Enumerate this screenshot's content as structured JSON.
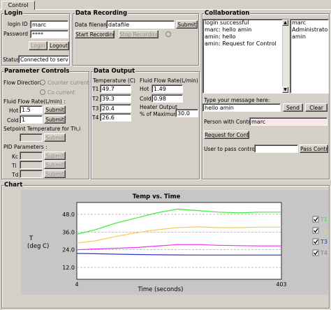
{
  "tab": {
    "label": "Control"
  },
  "login": {
    "title": "Login",
    "id_label": "login ID :",
    "id_value": "marc",
    "password_label": "Password :",
    "password_value": "****",
    "login_button": "Login",
    "logout_button": "Logout",
    "status_label": "Status",
    "status_value": "Connected to server"
  },
  "recording": {
    "title": "Data Recording",
    "filename_label": "Data filename",
    "filename_value": "datafile",
    "submit_button": "Submit",
    "start_button": "Start Recording",
    "stop_button": "Stop Recording"
  },
  "collaboration": {
    "title": "Collaboration",
    "messages": [
      "login successful",
      "marc: hello amin",
      "amin: hello",
      "amin: Request for Control"
    ],
    "users": [
      "marc",
      "Administrator",
      "amin"
    ],
    "type_label": "Type your message here:",
    "message_value": "hello amin",
    "send_button": "Send",
    "clear_button": "Clear",
    "person_label": "Person with Control",
    "person_value": "marc",
    "request_button": "Request for Control",
    "pass_label": "User to pass control to",
    "pass_value": "",
    "pass_button": "Pass Control"
  },
  "params": {
    "title": "Parameter Controls",
    "flow_direction_label": "Flow Direction",
    "counter_current": "Counter current",
    "co_current": "Co current",
    "flow_rate_label": "Fluid Flow Rate(L/min) :",
    "hot_label": "Hot",
    "hot_value": "1.5",
    "cold_label": "Cold",
    "cold_value": "1",
    "submit_label": "Submit",
    "setpoint_label": "Setpoint Temperature for Th,i",
    "pid_label": "PID Parameters :",
    "kc_label": "Kc",
    "ti_label": "Ti",
    "td_label": "Td"
  },
  "output": {
    "title": "Data Output",
    "temp_label": "Temperature (C)",
    "temps": [
      {
        "label": "T1",
        "value": "49.7"
      },
      {
        "label": "T2",
        "value": "39.3"
      },
      {
        "label": "T3",
        "value": "20.4"
      },
      {
        "label": "T4",
        "value": "26.6"
      }
    ],
    "flow_label_1": "Fluid Flow Rate(L/min)",
    "hot_label": "Hot",
    "hot_value": "1.49",
    "cold_label": "Cold",
    "cold_value": "0.98",
    "heater_label_1": "Heater Output",
    "heater_label_2": "% of Maximum",
    "heater_value": "30.0"
  },
  "chart_section": {
    "title": "Chart"
  },
  "chart_data": {
    "type": "line",
    "title": "Temp vs. Time",
    "xlabel": "Time (seconds)",
    "ylabel_line1": "T",
    "ylabel_line2": "(deg C)",
    "xlim": [
      4,
      403
    ],
    "ylim": [
      4,
      56
    ],
    "x_ticks": [
      "4",
      "403"
    ],
    "y_ticks": [
      "48.0",
      "36.0",
      "24.0",
      "12.0"
    ],
    "y_tick_values": [
      48,
      36,
      24,
      12
    ],
    "grid": true,
    "legend_position": "right",
    "series": [
      {
        "name": "T1",
        "color": "#33ee33",
        "x": [
          4,
          40,
          80,
          120,
          160,
          200,
          240,
          280,
          320,
          360,
          403
        ],
        "y": [
          34.5,
          37.5,
          42.0,
          45.5,
          49.0,
          51.5,
          50.5,
          49.5,
          49.0,
          49.5,
          49.5
        ]
      },
      {
        "name": "T2",
        "color": "#ffc850",
        "x": [
          4,
          40,
          80,
          120,
          160,
          200,
          240,
          280,
          320,
          360,
          403
        ],
        "y": [
          28.5,
          30.0,
          33.0,
          35.5,
          37.5,
          39.0,
          39.5,
          39.0,
          39.0,
          39.3,
          39.3
        ]
      },
      {
        "name": "T3",
        "color": "#3333cc",
        "x": [
          4,
          40,
          80,
          120,
          160,
          200,
          240,
          280,
          320,
          360,
          403
        ],
        "y": [
          21.5,
          21.3,
          21.0,
          20.8,
          20.6,
          20.5,
          20.4,
          20.4,
          20.4,
          20.4,
          20.4
        ]
      },
      {
        "name": "T4",
        "color": "#ee33ee",
        "x": [
          4,
          40,
          80,
          120,
          160,
          200,
          240,
          280,
          320,
          360,
          403
        ],
        "y": [
          24.0,
          24.5,
          25.0,
          25.5,
          26.5,
          27.5,
          27.5,
          27.0,
          26.8,
          26.6,
          26.6
        ]
      }
    ]
  }
}
